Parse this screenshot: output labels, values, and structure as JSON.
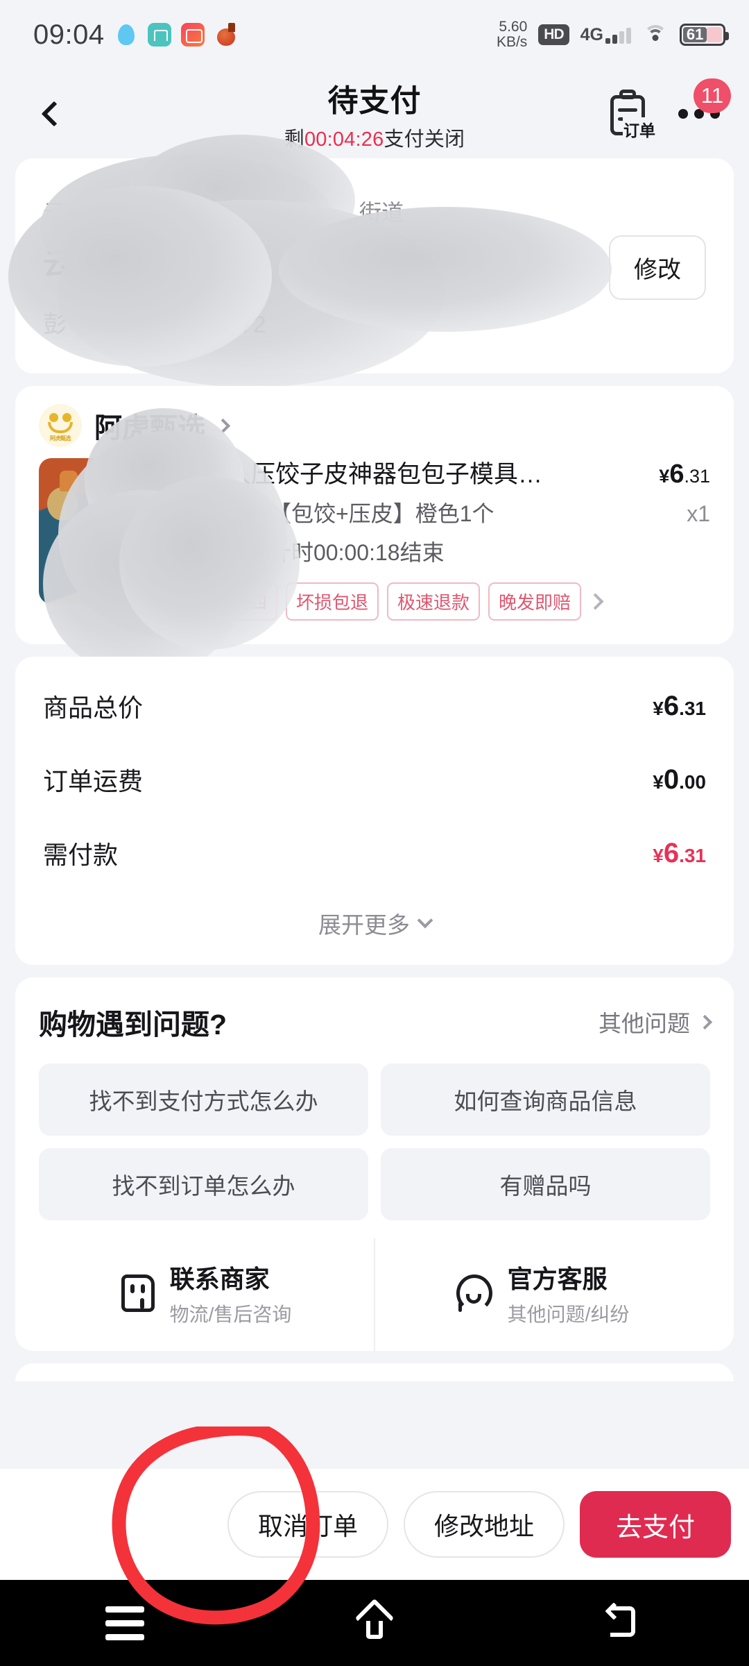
{
  "statusbar": {
    "time": "09:04",
    "app_icons": [
      "qq-icon",
      "housekeeping-icon",
      "kuaishou-icon",
      "taobao-icon"
    ],
    "net_speed_value": "5.60",
    "net_speed_unit": "KB/s",
    "hd_label": "HD",
    "network_label": "4G",
    "network_plus": "+",
    "battery_percent": "61",
    "wifi_icon": "wifi-icon"
  },
  "header": {
    "back_icon": "back-chevron-icon",
    "title": "待支付",
    "countdown_prefix": "剩",
    "countdown": "00:04:26",
    "countdown_suffix": "支付关闭",
    "order_icon": "clipboard-order-icon",
    "order_label": "订单",
    "more_icon": "more-dots-icon",
    "badge_count": "11"
  },
  "address": {
    "region": "云南省",
    "region_tail": "街道",
    "detail": "云",
    "person": "彭",
    "person_tail": "72",
    "edit_label": "修改"
  },
  "shop": {
    "logo_icon": "shop-logo-icon",
    "logo_text": "阿虎甄选",
    "name": "阿虎甄选",
    "chevron_icon": "chevron-right-icon"
  },
  "product": {
    "thumb_icon": "product-thumbnail",
    "title": "懒人压饺子皮神器包包子模具…",
    "price_currency": "¥",
    "price_int": "6",
    "price_dec": ".31",
    "spec": "二合一【包饺+压皮】橙色1个",
    "qty": "x1",
    "activity": "活动倒计时00:00:18结束",
    "tags": [
      "一赔四",
      "坏损包退",
      "极速退款",
      "晚发即赔"
    ],
    "tags_chevron_icon": "chevron-right-icon"
  },
  "summary": {
    "rows": [
      {
        "label": "商品总价",
        "currency": "¥",
        "int": "6",
        "dec": ".31",
        "accent": false
      },
      {
        "label": "订单运费",
        "currency": "¥",
        "int": "0",
        "dec": ".00",
        "accent": false
      },
      {
        "label": "需付款",
        "currency": "¥",
        "int": "6",
        "dec": ".31",
        "accent": true
      }
    ],
    "expand_label": "展开更多",
    "expand_icon": "chevron-down-icon"
  },
  "help": {
    "title": "购物遇到问题?",
    "other_label": "其他问题",
    "other_icon": "chevron-right-icon",
    "chips": [
      "找不到支付方式怎么办",
      "如何查询商品信息",
      "找不到订单怎么办",
      "有赠品吗"
    ],
    "contacts": [
      {
        "icon": "chat-bubble-icon",
        "main": "联系商家",
        "sub": "物流/售后咨询"
      },
      {
        "icon": "headset-support-icon",
        "main": "官方客服",
        "sub": "其他问题/纠纷"
      }
    ]
  },
  "actionbar": {
    "cancel_label": "取消订单",
    "edit_address_label": "修改地址",
    "pay_label": "去支付",
    "pay_color": "#e02b51",
    "annotation": "red-circle-annotation"
  },
  "navbar": {
    "recents_icon": "recents-icon",
    "home_icon": "home-icon",
    "back_icon": "back-icon"
  }
}
